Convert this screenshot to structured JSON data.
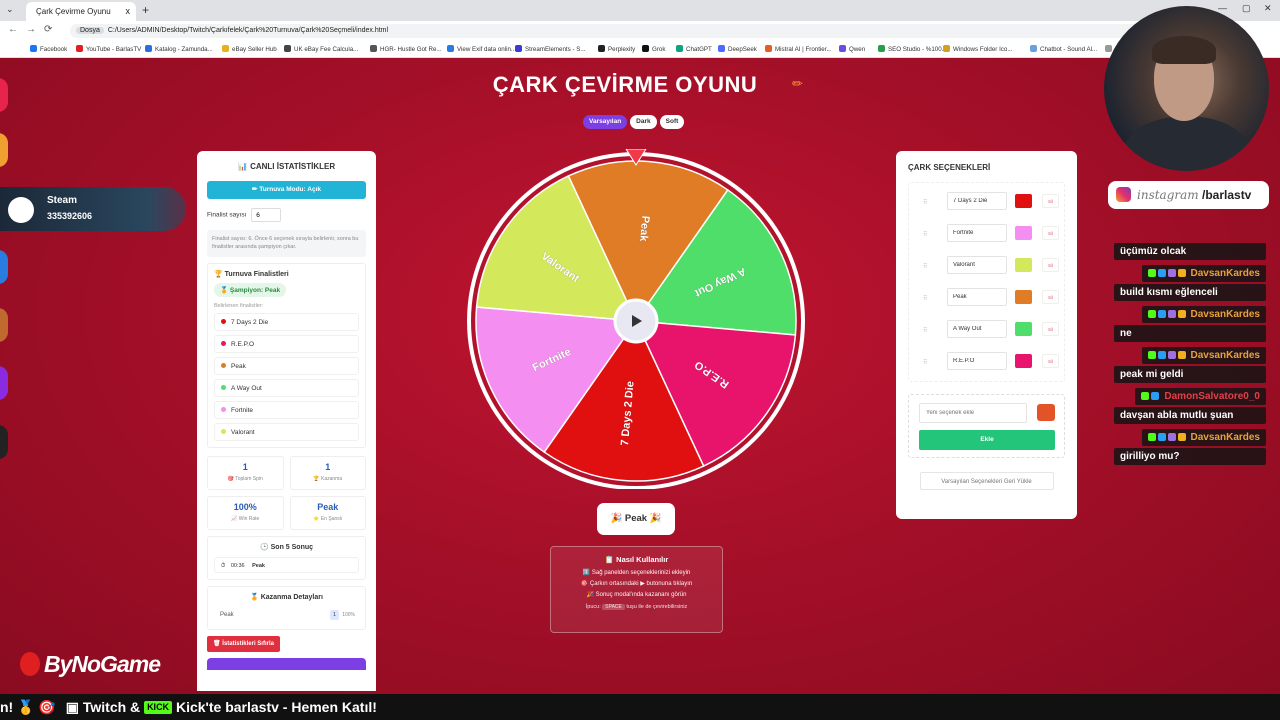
{
  "browser": {
    "tab_title": "Çark Çevirme Oyunu",
    "tab_close": "x",
    "new_tab": "+",
    "url_badge": "Dosya",
    "url": "C:/Users/ADMIN/Desktop/Twitch/Çarkıfelek/Çark%20Turnuva/Çark%20Seçmeli/index.html",
    "bookmarks": [
      "Facebook",
      "YouTube - BarlasTV",
      "Katalog - Zamunda...",
      "eBay Seller Hub",
      "UK eBay Fee Calcula...",
      "HGR- Hustle Got Re...",
      "View Exif data onlin...",
      "StreamElements - S...",
      "Perplexity",
      "Grok",
      "ChatGPT",
      "DeepSeek",
      "Mistral AI | Frontier...",
      "Qwen",
      "SEO Studio - %100...",
      "Windows Folder Ico...",
      "Chatbot - Sound Al...",
      "Yo"
    ]
  },
  "app": {
    "title": "ÇARK ÇEVİRME OYUNU",
    "themes": [
      "Varsayılan",
      "Dark",
      "Soft"
    ],
    "active_theme": "Varsayılan"
  },
  "stats_panel": {
    "title": "📊 CANLI İSTATİSTİKLER",
    "tournament_button": "✏ Turnuva Modu: Açık",
    "finalist_label": "Finalist sayısı",
    "finalist_value": "6",
    "note": "Finalist sayısı: 6. Önce 6 seçenek sırayla belirlenir, sonra bu finalistler arasında şampiyon çıkar.",
    "finalists_title": "🏆 Turnuva Finalistleri",
    "champion": "🏅 Şampiyon: Peak",
    "determined_label": "Belirlenen finalistler:",
    "finalists": [
      {
        "name": "7 Days 2 Die",
        "color": "#e01010"
      },
      {
        "name": "R.E.P.O",
        "color": "#e8146c"
      },
      {
        "name": "Peak",
        "color": "#e07b26"
      },
      {
        "name": "A Way Out",
        "color": "#4fde6a"
      },
      {
        "name": "Fortnite",
        "color": "#f48ef0"
      },
      {
        "name": "Valorant",
        "color": "#d4e85c"
      }
    ],
    "stats": [
      {
        "value": "1",
        "label": "🎯 Toplam Spin"
      },
      {
        "value": "1",
        "label": "🏆 Kazanma"
      },
      {
        "value": "100%",
        "label": "📈 Win Rate"
      },
      {
        "value": "Peak",
        "label": "⭐ En Şanslı"
      }
    ],
    "last5_title": "🕒 Son 5 Sonuç",
    "last5": [
      {
        "time": "00:36",
        "name": "Peak"
      }
    ],
    "win_details_title": "🏅 Kazanma Detayları",
    "win_details": [
      {
        "name": "Peak",
        "count": "1",
        "pct": "100%"
      }
    ],
    "reset_stats_button": "🗑 İstatistikleri Sıfırla"
  },
  "wheel": {
    "segments": [
      {
        "label": "Peak",
        "color": "#e07b26"
      },
      {
        "label": "A Way Out",
        "color": "#4fde6a"
      },
      {
        "label": "R.E.P.O",
        "color": "#e8146c"
      },
      {
        "label": "7 Days 2 Die",
        "color": "#e01010"
      },
      {
        "label": "Fortnite",
        "color": "#f48ef0"
      },
      {
        "label": "Valorant",
        "color": "#d4e85c"
      }
    ],
    "result": "🎉 Peak 🎉"
  },
  "howto": {
    "title": "📋 Nasıl Kullanılır",
    "steps": [
      "1️⃣ Sağ panelden seçeneklerinizi ekleyin",
      "🎯 Çarkın ortasındaki ▶ butonuna tıklayın",
      "🎉 Sonuç modal'ında kazananı görün"
    ],
    "tip_prefix": "İpucu:",
    "tip_key": "SPACE",
    "tip_suffix": "tuşu ile de çevirebilirsiniz"
  },
  "options_panel": {
    "title": "ÇARK SEÇENEKLERİ",
    "options": [
      {
        "label": "7 Days 2 Die",
        "color": "#e01010"
      },
      {
        "label": "Fortnite",
        "color": "#f48ef0"
      },
      {
        "label": "Valorant",
        "color": "#d4e85c"
      },
      {
        "label": "Peak",
        "color": "#e07b26"
      },
      {
        "label": "A Way Out",
        "color": "#4fde6a"
      },
      {
        "label": "R.E.P.O",
        "color": "#e8146c"
      }
    ],
    "delete_label": "Sil",
    "new_placeholder": "Yeni seçenek ekle",
    "new_color": "#e25428",
    "add_button": "Ekle",
    "reset_button": "Varsayılan Seçenekleri Geri Yükle"
  },
  "overlay": {
    "steam_name": "Steam",
    "steam_id": "335392606",
    "instagram_prefix": "instagram",
    "instagram_handle": "/barlastv",
    "chat": [
      {
        "type": "msg",
        "text": "üçümüz olcak"
      },
      {
        "type": "name",
        "text": "DavsanKardes"
      },
      {
        "type": "msg",
        "text": "build kısmı eğlenceli"
      },
      {
        "type": "name",
        "text": "DavsanKardes"
      },
      {
        "type": "msg",
        "text": "ne"
      },
      {
        "type": "name",
        "text": "DavsanKardes"
      },
      {
        "type": "msg",
        "text": "peak mi geldi"
      },
      {
        "type": "name",
        "text": "DamonSalvatore0_0",
        "red": true
      },
      {
        "type": "msg",
        "text": "davşan abla mutlu şuan"
      },
      {
        "type": "name",
        "text": "DavsanKardes"
      },
      {
        "type": "msg",
        "text": "girilliyo mu?"
      }
    ],
    "sponsor": "ByNoGame",
    "ticker_left": "n! 🥇 🎯",
    "ticker_kick_badge": "KICK",
    "ticker_text_a": "Twitch &",
    "ticker_text_b": "Kick'te barlastv - Hemen Katıl!"
  }
}
